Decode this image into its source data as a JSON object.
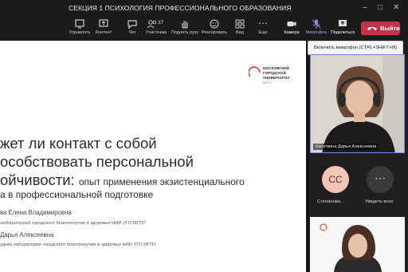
{
  "window": {
    "title": "СЕКЦИЯ 1 ПСИХОЛОГИЯ ПРОФЕССИОНАЛЬНОГО ОБРАЗОВАНИЯ"
  },
  "toolbar": {
    "send": "Управлять",
    "content": "Контент",
    "chat": "Чат",
    "participants": "Участники",
    "participants_count": "37",
    "raise_hand": "Поднять руку",
    "react": "Реагировать",
    "view": "Вид",
    "more": "Еще",
    "camera": "Камера",
    "mic": "Микрофон",
    "share": "Поделиться",
    "leave": "Выйти"
  },
  "tooltip": "Включить микрофон (CTRL+SHIFT+M)",
  "slide": {
    "logo_line1": "МОСКОВСКИЙ",
    "logo_line2": "ГОРОДСКОЙ",
    "logo_line3": "УНИВЕРСИТЕТ",
    "logo_line4": "МГПУ",
    "title_line1": "жет ли контакт с собой",
    "title_line2": "особствовать персональной",
    "title_line3": "ойчивости:",
    "title_line3_sub": "опыт применения экзистенциального",
    "title_line4_sub": "а в профессиональной подготовке",
    "author1_name": "ва Елена Владимировна",
    "author1_aff": "лабораторией городского благополучия и здоровья НИИ УГО МГПУ",
    "author2_name": "Дарья Алексеевна",
    "author2_aff": "удник лаборатории городского благополучия и здоровья НИИ УГО МГПУ"
  },
  "participants": {
    "video1_name": "Касаткина Дарья Алексеевна",
    "avatar_initials": "СС",
    "avatar_label": "Степанова...",
    "see_all": "Увидеть всех"
  },
  "colors": {
    "leave": "#c4314b",
    "accent": "#7f85f5",
    "logo_red": "#d8322c"
  }
}
